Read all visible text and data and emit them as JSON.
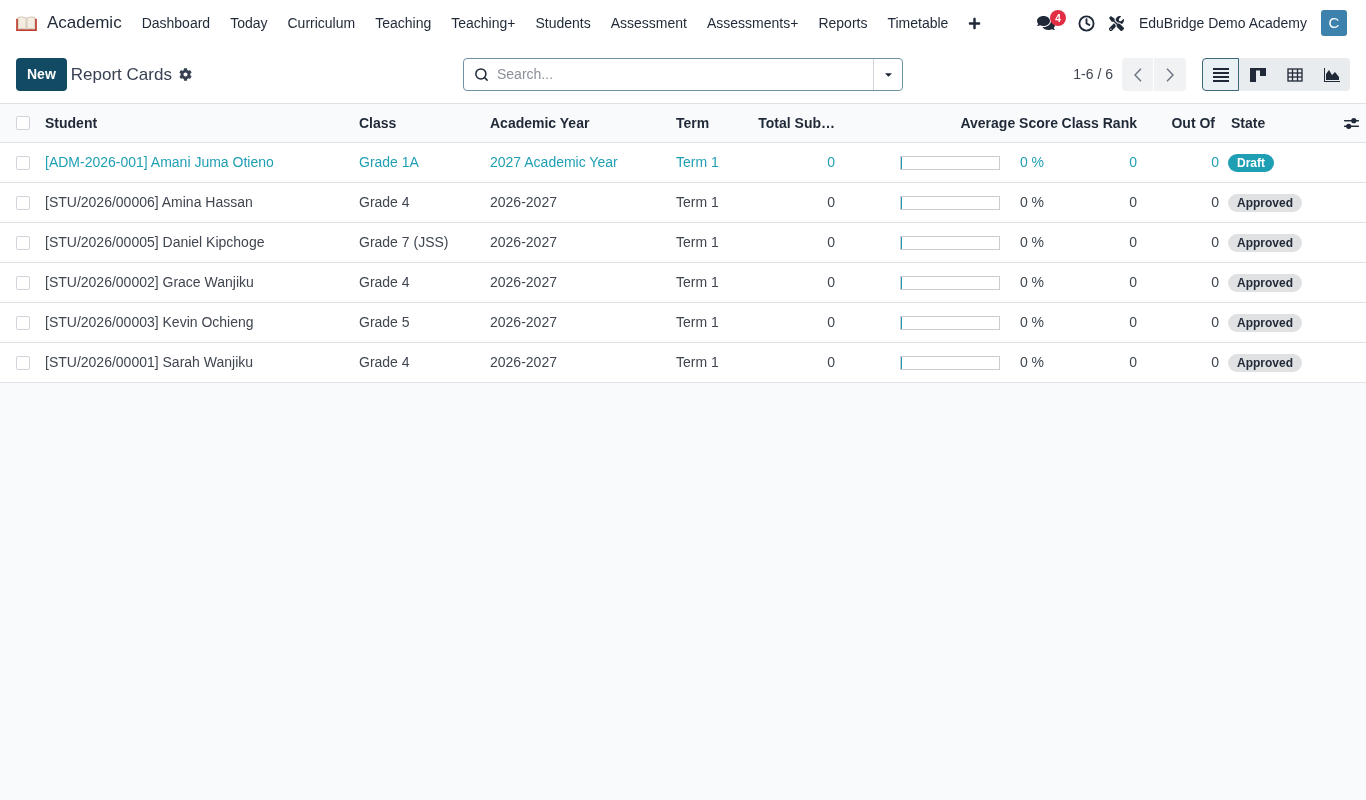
{
  "navbar": {
    "app_name": "Academic",
    "menu": [
      "Dashboard",
      "Today",
      "Curriculum",
      "Teaching",
      "Teaching+",
      "Students",
      "Assessment",
      "Assessments+",
      "Reports",
      "Timetable"
    ],
    "messages_badge": "4",
    "company": "EduBridge Demo Academy",
    "avatar_initial": "C"
  },
  "control_panel": {
    "new_button": "New",
    "title": "Report Cards",
    "search": {
      "placeholder": "Search..."
    },
    "pager": "1-6 / 6",
    "views": [
      {
        "kind": "list",
        "selected": true
      },
      {
        "kind": "kanban",
        "selected": false
      },
      {
        "kind": "pivot",
        "selected": false
      },
      {
        "kind": "graph",
        "selected": false
      }
    ]
  },
  "table": {
    "select_all": {
      "checked": false
    },
    "columns": [
      "Student",
      "Class",
      "Academic Year",
      "Term",
      "Total Sub…",
      "Average Score",
      "Class Rank",
      "Out Of",
      "State"
    ],
    "rows": [
      {
        "checked": false,
        "student": "[ADM-2026-001] Amani Juma Otieno",
        "class": "Grade 1A",
        "academic_year": "2027 Academic Year",
        "term": "Term 1",
        "total_sub": "0",
        "average_score": {
          "level": 0,
          "reading": "0 %"
        },
        "class_rank": "0",
        "out_of": "0",
        "state": {
          "label": "Draft",
          "kind": "draft"
        }
      },
      {
        "checked": false,
        "student": "[STU/2026/00006] Amina Hassan",
        "class": "Grade 4",
        "academic_year": "2026-2027",
        "term": "Term 1",
        "total_sub": "0",
        "average_score": {
          "level": 0,
          "reading": "0 %"
        },
        "class_rank": "0",
        "out_of": "0",
        "state": {
          "label": "Approved",
          "kind": "approved"
        }
      },
      {
        "checked": false,
        "student": "[STU/2026/00005] Daniel Kipchoge",
        "class": "Grade 7 (JSS)",
        "academic_year": "2026-2027",
        "term": "Term 1",
        "total_sub": "0",
        "average_score": {
          "level": 0,
          "reading": "0 %"
        },
        "class_rank": "0",
        "out_of": "0",
        "state": {
          "label": "Approved",
          "kind": "approved"
        }
      },
      {
        "checked": false,
        "student": "[STU/2026/00002] Grace Wanjiku",
        "class": "Grade 4",
        "academic_year": "2026-2027",
        "term": "Term 1",
        "total_sub": "0",
        "average_score": {
          "level": 0,
          "reading": "0 %"
        },
        "class_rank": "0",
        "out_of": "0",
        "state": {
          "label": "Approved",
          "kind": "approved"
        }
      },
      {
        "checked": false,
        "student": "[STU/2026/00003] Kevin Ochieng",
        "class": "Grade 5",
        "academic_year": "2026-2027",
        "term": "Term 1",
        "total_sub": "0",
        "average_score": {
          "level": 0,
          "reading": "0 %"
        },
        "class_rank": "0",
        "out_of": "0",
        "state": {
          "label": "Approved",
          "kind": "approved"
        }
      },
      {
        "checked": false,
        "student": "[STU/2026/00001] Sarah Wanjiku",
        "class": "Grade 4",
        "academic_year": "2026-2027",
        "term": "Term 1",
        "total_sub": "0",
        "average_score": {
          "level": 0,
          "reading": "0 %"
        },
        "class_rank": "0",
        "out_of": "0",
        "state": {
          "label": "Approved",
          "kind": "approved"
        }
      }
    ]
  }
}
